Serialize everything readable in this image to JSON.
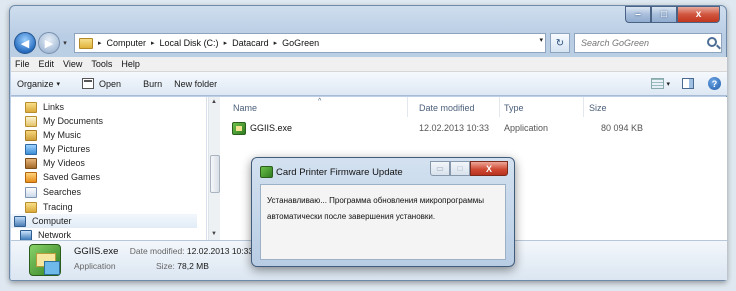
{
  "window": {
    "caption_min": "–",
    "caption_max": "□",
    "caption_close": "x"
  },
  "address": {
    "crumbs": [
      "Computer",
      "Local Disk (C:)",
      "Datacard",
      "GoGreen"
    ],
    "separator": "▸",
    "dropdown": "▾",
    "refresh": "↻"
  },
  "search": {
    "placeholder": "Search GoGreen"
  },
  "menubar": {
    "items": [
      "File",
      "Edit",
      "View",
      "Tools",
      "Help"
    ]
  },
  "toolbar": {
    "organize": "Organize",
    "open": "Open",
    "burn": "Burn",
    "new_folder": "New folder",
    "help": "?"
  },
  "nav_pane": {
    "items": [
      {
        "label": "Links",
        "icon": "links-icon"
      },
      {
        "label": "My Documents",
        "icon": "documents-icon"
      },
      {
        "label": "My Music",
        "icon": "music-icon"
      },
      {
        "label": "My Pictures",
        "icon": "pictures-icon"
      },
      {
        "label": "My Videos",
        "icon": "videos-icon"
      },
      {
        "label": "Saved Games",
        "icon": "saved-games-icon"
      },
      {
        "label": "Searches",
        "icon": "searches-icon"
      },
      {
        "label": "Tracing",
        "icon": "folder-icon"
      },
      {
        "label": "Computer",
        "icon": "computer-icon"
      },
      {
        "label": "Network",
        "icon": "network-icon"
      }
    ]
  },
  "file_list": {
    "columns": [
      "Name",
      "Date modified",
      "Type",
      "Size"
    ],
    "rows": [
      {
        "name": "GGIIS.exe",
        "date": "12.02.2013 10:33",
        "type": "Application",
        "size": "80 094 KB"
      }
    ]
  },
  "dialog": {
    "title": "Card Printer Firmware Update",
    "close": "X",
    "line1": "Устанавливаю... Программа обновления микропрограммы",
    "line2": "автоматически после завершения установки."
  },
  "details": {
    "name": "GGIIS.exe",
    "date_label": "Date modified:",
    "date_value": "12.02.2013 10:33",
    "type": "Application",
    "size_label": "Size:",
    "size_value": "78,2 MB"
  }
}
